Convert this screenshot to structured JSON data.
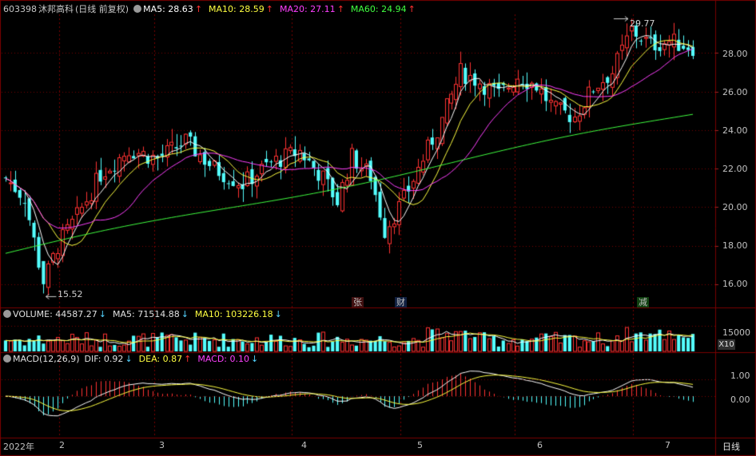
{
  "stock": {
    "code": "603398",
    "name": "沐邦高科",
    "period": "(日线 前复权)"
  },
  "ma": [
    {
      "label": "MA5: 28.63",
      "arrow": "↑",
      "color": "#ffffff"
    },
    {
      "label": "MA10: 28.59",
      "arrow": "↑",
      "color": "#ffff40"
    },
    {
      "label": "MA20: 27.11",
      "arrow": "↑",
      "color": "#ff40ff"
    },
    {
      "label": "MA60: 24.94",
      "arrow": "↑",
      "color": "#40ff40"
    }
  ],
  "volume_header": {
    "volume": "VOLUME: 44587.27",
    "volume_arrow": "↓",
    "ma5": "MA5: 71514.88",
    "ma5_arrow": "↓",
    "ma10": "MA10: 103226.18",
    "ma10_arrow": "↓"
  },
  "macd_header": {
    "title": "MACD(12,26,9)",
    "dif": "DIF: 0.92",
    "dif_arrow": "↓",
    "dea": "DEA: 0.87",
    "dea_arrow": "↑",
    "macd": "MACD: 0.10",
    "macd_arrow": "↓"
  },
  "annotations": {
    "high": "29.77",
    "low": "15.52"
  },
  "price_axis": [
    "28.00",
    "26.00",
    "24.00",
    "22.00",
    "20.00",
    "18.00",
    "16.00"
  ],
  "volume_axis": {
    "value": "15000",
    "unit": "X10"
  },
  "macd_axis": [
    "1.00",
    "0.00"
  ],
  "time_axis": {
    "labels": [
      "2022年",
      "2",
      "3",
      "4",
      "5",
      "6",
      "7"
    ],
    "period_button": "日线"
  },
  "events": [
    {
      "text": "张",
      "color": "#ff4040"
    },
    {
      "text": "财",
      "color": "#40a0ff"
    },
    {
      "text": "减",
      "color": "#40ff40"
    }
  ],
  "colors": {
    "up": "#ff3232",
    "down": "#54ffff",
    "grid": "#7a0000",
    "axis_text": "#c0c0c0"
  },
  "chart_data": {
    "type": "candlestick",
    "price_range": [
      15,
      30
    ],
    "price_ticks": [
      16,
      18,
      20,
      22,
      24,
      26,
      28
    ],
    "volume_tick": 15000,
    "macd_range": [
      -2.3,
      1.9
    ],
    "macd_ticks": [
      0,
      1
    ],
    "months": [
      {
        "label": "2",
        "index": 12
      },
      {
        "label": "3",
        "index": 32
      },
      {
        "label": "4",
        "index": 61
      },
      {
        "label": "5",
        "index": 84
      },
      {
        "label": "6",
        "index": 108
      },
      {
        "label": "7",
        "index": 133
      }
    ],
    "events": [
      {
        "text": "张",
        "index": 71
      },
      {
        "text": "财",
        "index": 80
      },
      {
        "text": "减",
        "index": 128
      }
    ],
    "high": {
      "value": 29.77,
      "index": 132
    },
    "low": {
      "value": 15.52,
      "index": 8
    },
    "ma_last": {
      "ma5": 28.63,
      "ma10": 28.59,
      "ma20": 27.11,
      "ma60": 24.94
    },
    "last_volume": 44587.27
  }
}
